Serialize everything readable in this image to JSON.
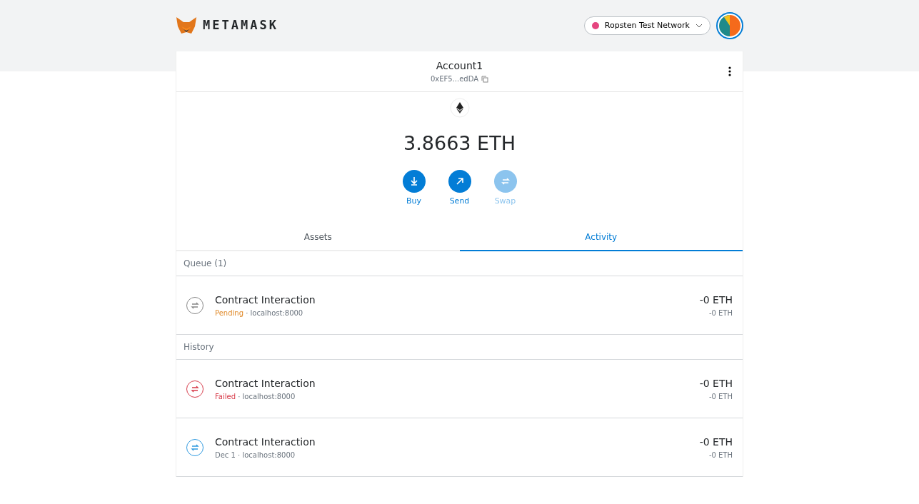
{
  "header": {
    "logo_text": "METAMASK",
    "network": {
      "name": "Ropsten Test Network",
      "color": "#e5457f"
    }
  },
  "account": {
    "name": "Account1",
    "address": "0xEF5...edDA"
  },
  "balance": "3.8663 ETH",
  "actions": [
    {
      "label": "Buy",
      "kind": "buy",
      "disabled": false
    },
    {
      "label": "Send",
      "kind": "send",
      "disabled": false
    },
    {
      "label": "Swap",
      "kind": "swap",
      "disabled": true
    }
  ],
  "tabs": [
    {
      "label": "Assets",
      "selected": false
    },
    {
      "label": "Activity",
      "selected": true
    }
  ],
  "sections": [
    {
      "title": "Queue (1)",
      "transactions": [
        {
          "title": "Contract Interaction",
          "kind": "pending",
          "status": "Pending",
          "detail": " · localhost:8000",
          "amount": "-0 ETH",
          "fiat": "-0 ETH"
        }
      ]
    },
    {
      "title": "History",
      "transactions": [
        {
          "title": "Contract Interaction",
          "kind": "failed",
          "status": "Failed",
          "detail": " · localhost:8000",
          "amount": "-0 ETH",
          "fiat": "-0 ETH"
        },
        {
          "title": "Contract Interaction",
          "kind": "confirmed",
          "status": "Dec 1",
          "detail": " · localhost:8000",
          "amount": "-0 ETH",
          "fiat": "-0 ETH"
        }
      ]
    }
  ]
}
